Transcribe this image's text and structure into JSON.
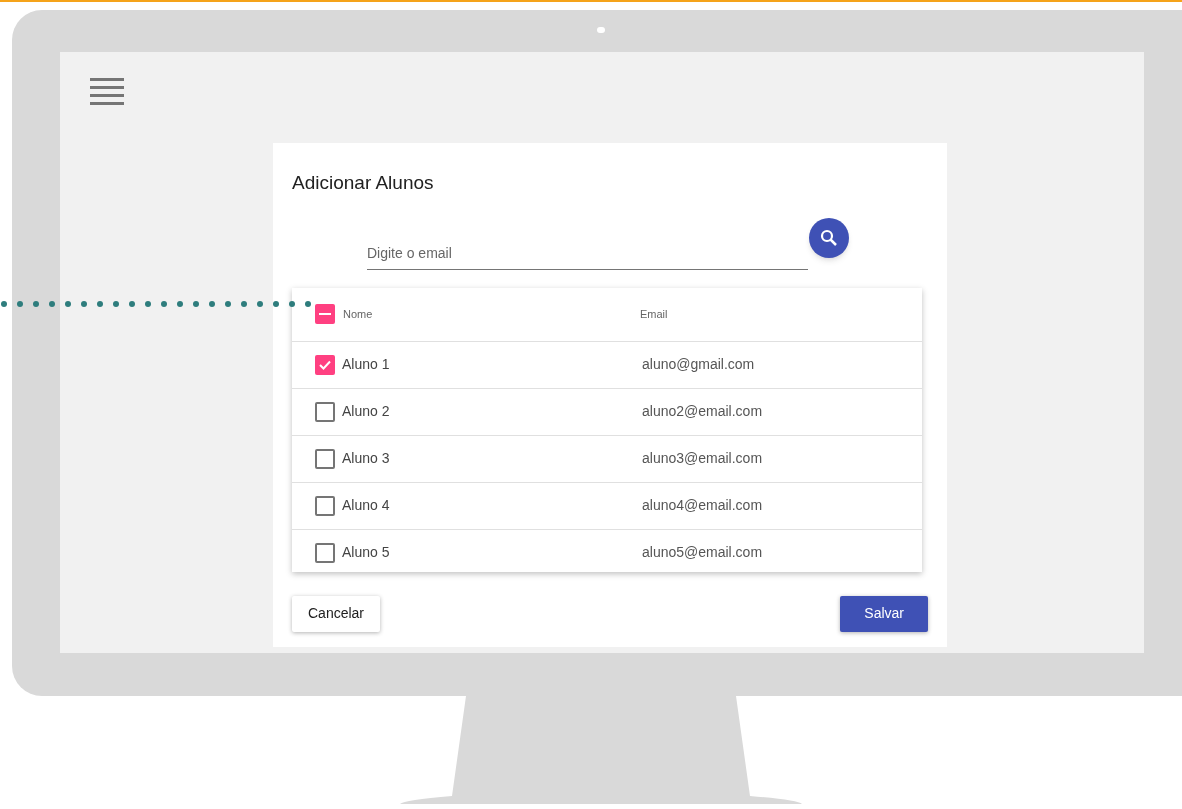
{
  "dialog": {
    "title": "Adicionar Alunos",
    "search": {
      "placeholder": "Digite o email"
    },
    "table": {
      "select_all": {
        "indeterminate": true
      },
      "columns": [
        "Nome",
        "Email"
      ],
      "rows": [
        {
          "name": "Aluno 1",
          "email": "aluno@gmail.com",
          "checked": true
        },
        {
          "name": "Aluno 2",
          "email": "aluno2@email.com",
          "checked": false
        },
        {
          "name": "Aluno 3",
          "email": "aluno3@email.com",
          "checked": false
        },
        {
          "name": "Aluno 4",
          "email": "aluno4@email.com",
          "checked": false
        },
        {
          "name": "Aluno 5",
          "email": "aluno5@email.com",
          "checked": false
        }
      ]
    },
    "buttons": {
      "cancel": "Cancelar",
      "save": "Salvar"
    }
  }
}
